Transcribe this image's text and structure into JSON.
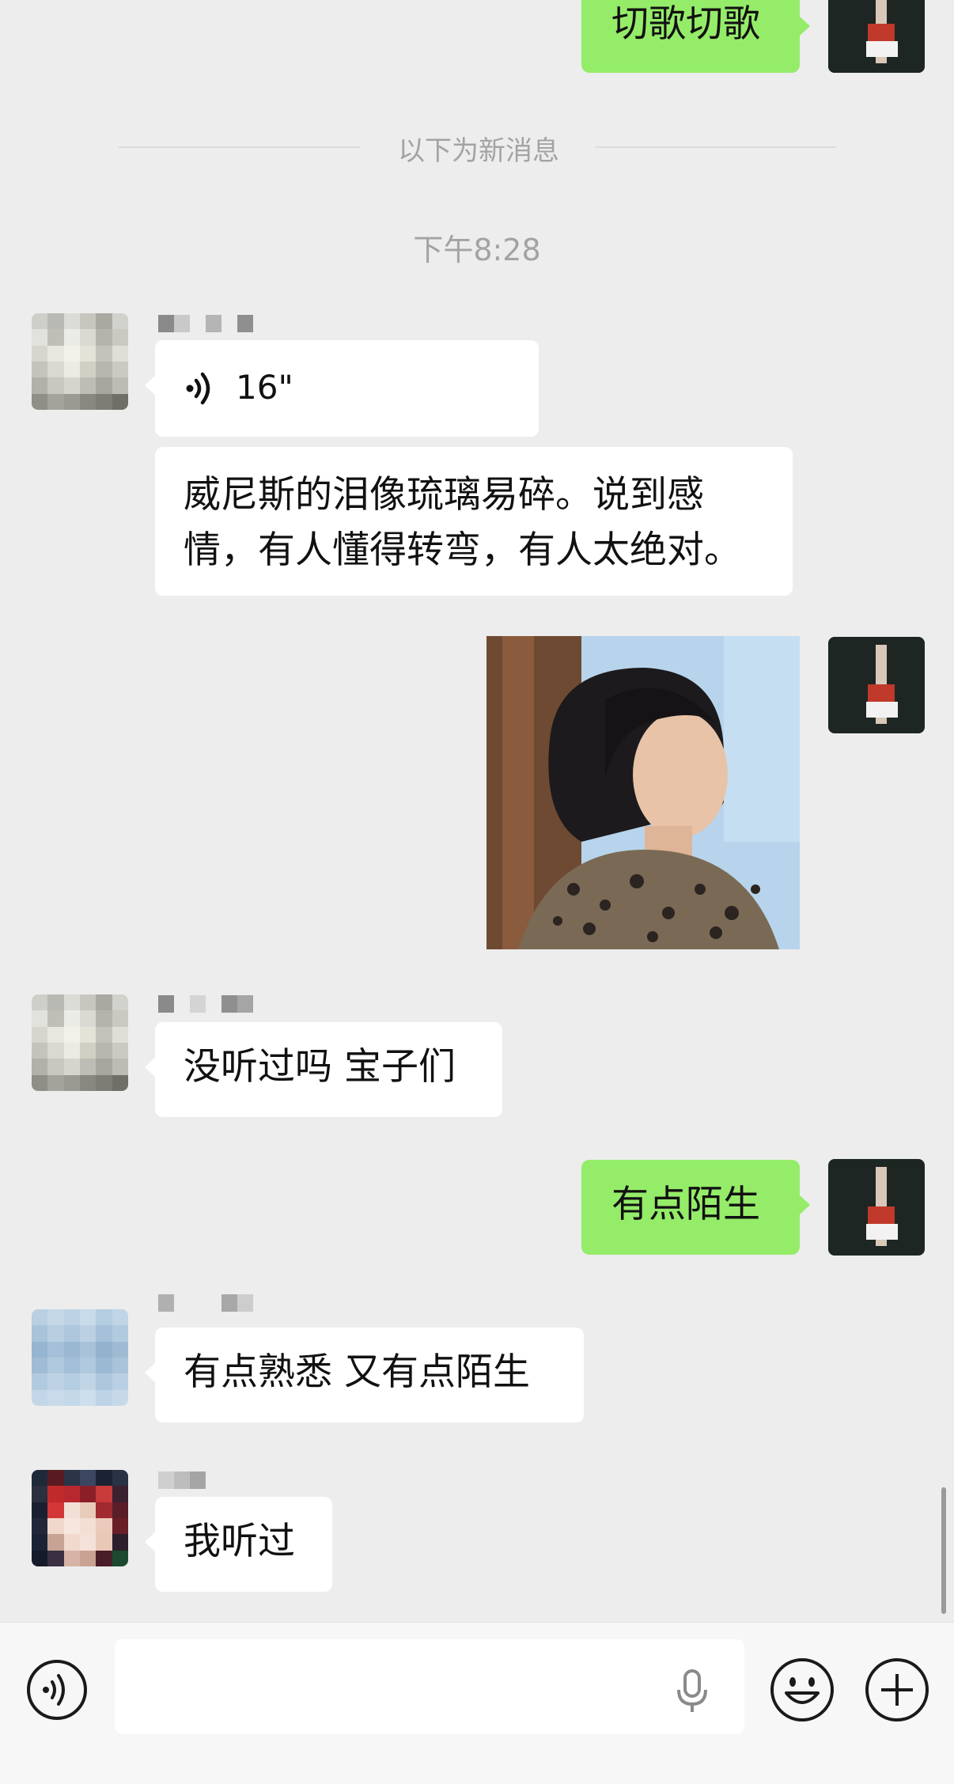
{
  "messages": {
    "m0": {
      "text": "切歌切歌"
    },
    "divider": {
      "text": "以下为新消息"
    },
    "time": {
      "text": "下午8:28"
    },
    "voice": {
      "duration": "16\""
    },
    "lyrics": {
      "line1": "威尼斯的泪像琉璃易碎。说到感",
      "line2": "情，有人懂得转弯，有人太绝对。"
    },
    "m_q": {
      "text": "没听过吗 宝子们"
    },
    "m_reply": {
      "text": "有点陌生"
    },
    "m_familiar": {
      "text": "有点熟悉 又有点陌生"
    },
    "m_heard": {
      "text": "我听过"
    }
  },
  "icons": {
    "voice_mode": "voice-mode-icon",
    "microphone": "microphone-icon",
    "emoji": "emoji-icon",
    "more": "plus-icon",
    "voice_wave": "voice-wave-icon"
  },
  "colors": {
    "background": "#ededed",
    "my_bubble": "#95ec69",
    "other_bubble": "#ffffff",
    "system_text": "#a3a3a3"
  }
}
